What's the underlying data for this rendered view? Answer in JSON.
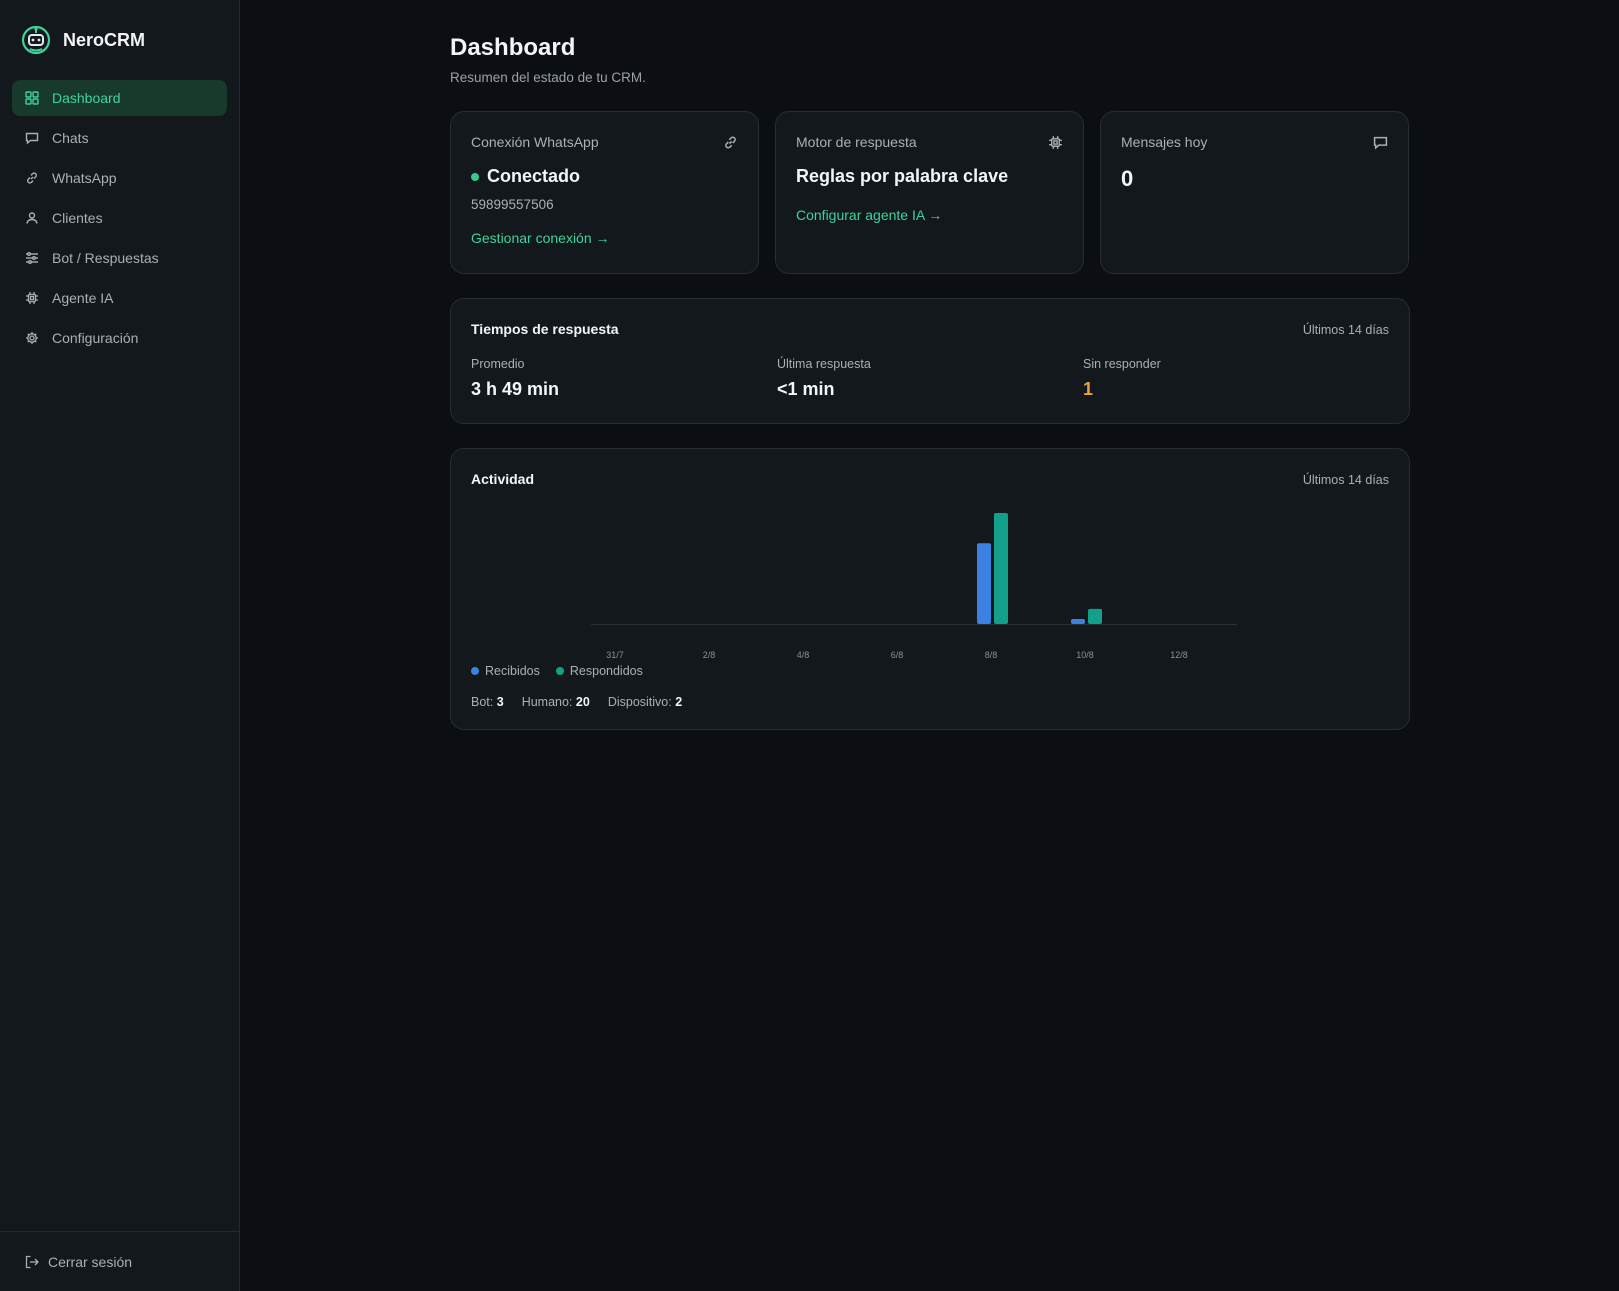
{
  "brand": {
    "name": "NeroCRM",
    "logo_icon": "robot-icon",
    "accent": "#3fd39a"
  },
  "sidebar": {
    "items": [
      {
        "label": "Dashboard",
        "icon": "grid-icon",
        "active": true
      },
      {
        "label": "Chats",
        "icon": "chat-icon"
      },
      {
        "label": "WhatsApp",
        "icon": "link-icon"
      },
      {
        "label": "Clientes",
        "icon": "user-icon"
      },
      {
        "label": "Bot / Respuestas",
        "icon": "sliders-icon"
      },
      {
        "label": "Agente IA",
        "icon": "chip-icon"
      },
      {
        "label": "Configuración",
        "icon": "gear-icon"
      }
    ],
    "logout_label": "Cerrar sesión"
  },
  "header": {
    "title": "Dashboard",
    "subtitle": "Resumen del estado de tu CRM."
  },
  "cards": {
    "whatsapp": {
      "label": "Conexión WhatsApp",
      "status": "Conectado",
      "phone": "59899557506",
      "link": "Gestionar conexión →"
    },
    "engine": {
      "label": "Motor de respuesta",
      "value": "Reglas por palabra clave",
      "link": "Configurar agente IA →"
    },
    "messages": {
      "label": "Mensajes hoy",
      "value": "0"
    }
  },
  "response_times": {
    "title": "Tiempos de respuesta",
    "range": "Últimos 14 días",
    "metrics": [
      {
        "label": "Promedio",
        "value": "3 h 49 min"
      },
      {
        "label": "Última respuesta",
        "value": "<1 min"
      },
      {
        "label": "Sin responder",
        "value": "1"
      }
    ]
  },
  "activity": {
    "title": "Actividad",
    "range": "Últimos 14 días",
    "legend": [
      {
        "label": "Recibidos",
        "color": "#3b82e0"
      },
      {
        "label": "Respondidos",
        "color": "#12a08a"
      }
    ],
    "counts": [
      {
        "label": "Bot:",
        "value": "3"
      },
      {
        "label": "Humano:",
        "value": "20"
      },
      {
        "label": "Dispositivo:",
        "value": "2"
      }
    ]
  },
  "chart_data": {
    "type": "bar",
    "categories": [
      "31/7",
      "1/8",
      "2/8",
      "3/8",
      "4/8",
      "5/8",
      "6/8",
      "7/8",
      "8/8",
      "9/8",
      "10/8",
      "11/8",
      "12/8",
      "13/8"
    ],
    "tick_labels": [
      "31/7",
      "2/8",
      "4/8",
      "6/8",
      "8/8",
      "10/8",
      "12/8"
    ],
    "series": [
      {
        "name": "Recibidos",
        "color": "#3b82e0",
        "values": [
          0,
          0,
          0,
          0,
          0,
          0,
          0,
          0,
          16,
          0,
          1,
          0,
          0,
          0
        ]
      },
      {
        "name": "Respondidos",
        "color": "#12a08a",
        "values": [
          0,
          0,
          0,
          0,
          0,
          0,
          0,
          0,
          22,
          0,
          3,
          0,
          0,
          0
        ]
      }
    ],
    "ylim": [
      0,
      22
    ],
    "grid": false,
    "legend": "bottom-left"
  }
}
